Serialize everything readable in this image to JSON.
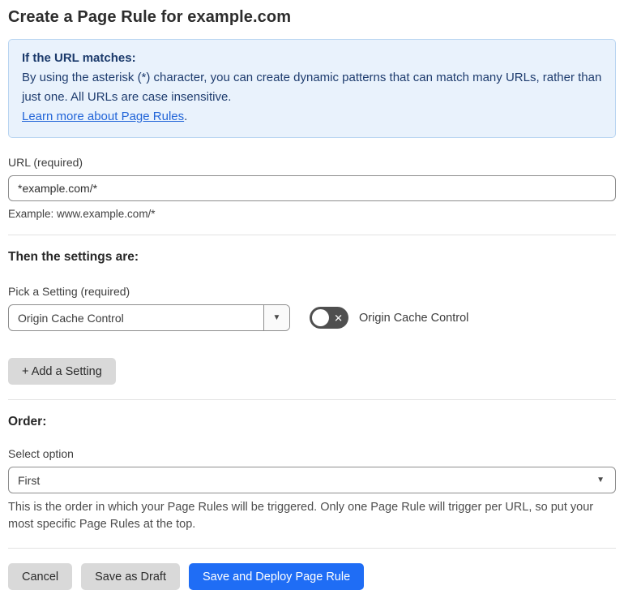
{
  "page": {
    "title": "Create a Page Rule for example.com"
  },
  "info_box": {
    "heading": "If the URL matches:",
    "body": "By using the asterisk (*) character, you can create dynamic patterns that can match many URLs, rather than just one. All URLs are case insensitive.",
    "link": "Learn more about Page Rules",
    "link_suffix": "."
  },
  "url_field": {
    "label": "URL (required)",
    "value": "*example.com/*",
    "helper": "Example: www.example.com/*"
  },
  "settings_section": {
    "heading": "Then the settings are:",
    "pick_label": "Pick a Setting (required)",
    "selected_setting": "Origin Cache Control",
    "toggle_label": "Origin Cache Control",
    "toggle_state": "off",
    "add_button_label": "+ Add a Setting"
  },
  "order_section": {
    "heading": "Order:",
    "select_label": "Select option",
    "selected_option": "First",
    "helper": "This is the order in which your Page Rules will be triggered. Only one Page Rule will trigger per URL, so put your most specific Page Rules at the top."
  },
  "footer": {
    "cancel_label": "Cancel",
    "save_draft_label": "Save as Draft",
    "save_deploy_label": "Save and Deploy Page Rule"
  },
  "icons": {
    "caret_down": "▼",
    "toggle_off_x": "✕"
  },
  "colors": {
    "primary_blue": "#1f6df5",
    "info_bg": "#e9f2fc",
    "info_border": "#b9d5f1",
    "info_text": "#1e3c6e",
    "link_blue": "#2265d8",
    "toggle_off_bg": "#4f4f4f",
    "button_gray": "#d9d9d9"
  }
}
